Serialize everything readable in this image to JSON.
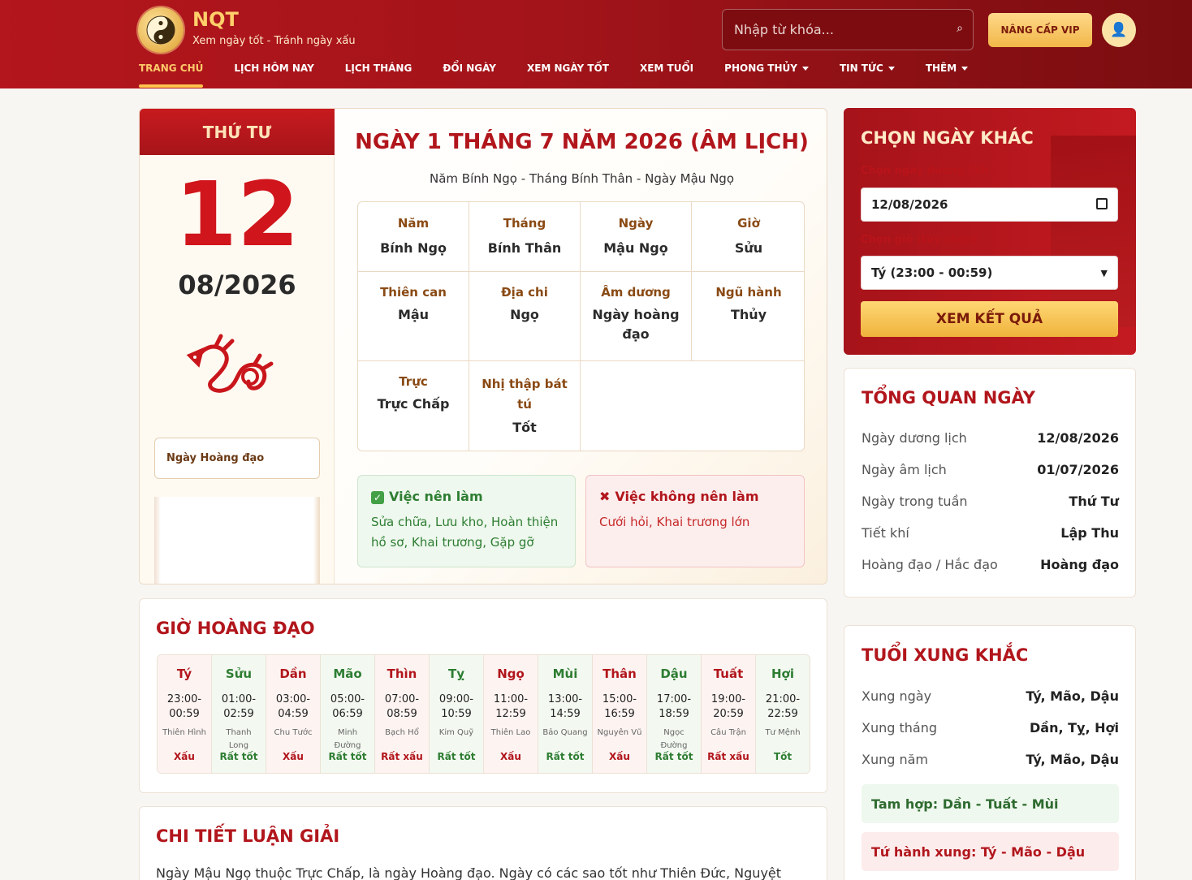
{
  "header": {
    "brand": "NQT",
    "tagline": "Xem ngày tốt - Tránh ngày xấu",
    "search_placeholder": "Nhập từ khóa...",
    "vip_label": "NÂNG CẤP VIP",
    "nav": [
      {
        "label": "TRANG CHỦ",
        "active": true
      },
      {
        "label": "LỊCH HÔM NAY"
      },
      {
        "label": "LỊCH THÁNG"
      },
      {
        "label": "ĐỔI NGÀY"
      },
      {
        "label": "XEM NGÀY TỐT"
      },
      {
        "label": "XEM TUỔI"
      },
      {
        "label": "PHONG THỦY",
        "dropdown": true
      },
      {
        "label": "TIN TỨC",
        "dropdown": true
      },
      {
        "label": "THÊM",
        "dropdown": true
      }
    ]
  },
  "date_card": {
    "weekday": "THỨ TƯ",
    "day": "12",
    "month_year": "08/2026",
    "hoangdao_label": "Ngày Hoàng đạo",
    "lunar_title": "NGÀY 1 THÁNG 7 NĂM 2026 (ÂM LỊCH)",
    "lunar_sub": "Năm Bính Ngọ - Tháng Bính Thân - Ngày Mậu Ngọ",
    "grid": {
      "nam": {
        "label": "Năm",
        "value": "Bính Ngọ"
      },
      "thang": {
        "label": "Tháng",
        "value": "Bính Thân"
      },
      "ngay": {
        "label": "Ngày",
        "value": "Mậu Ngọ"
      },
      "gio": {
        "label": "Giờ",
        "value": "Sửu"
      },
      "thien_can": {
        "label": "Thiên can",
        "value": "Mậu"
      },
      "dia_chi": {
        "label": "Địa chi",
        "value": "Ngọ"
      },
      "am_duong": {
        "label": "Âm dương",
        "value": "Ngày hoàng đạo"
      },
      "ngu_hanh": {
        "label": "Ngũ hành",
        "value": "Thủy"
      },
      "truc": {
        "label": "Trực",
        "value": "Trực Chấp"
      },
      "nhi_thap": {
        "label": "Nhị thập bát tú",
        "value": "Tốt"
      }
    },
    "do_title": "Việc nên làm",
    "do_text": "Sửa chữa, Lưu kho, Hoàn thiện hồ sơ, Khai trương, Gặp gỡ",
    "dont_title": "Việc không nên làm",
    "dont_text": "Cưới hỏi, Khai trương lớn"
  },
  "chon_ngay": {
    "title": "CHỌN NGÀY KHÁC",
    "date_label": "Chọn ngày dương lịch",
    "date_value": "12/08/2026",
    "hour_label": "Chọn giờ (tùy chọn)",
    "hour_value": "Tý (23:00 - 00:59)",
    "button": "XEM KẾT QUẢ"
  },
  "tong_quan": {
    "title": "TỔNG QUAN NGÀY",
    "rows": [
      {
        "k": "Ngày dương lịch",
        "v": "12/08/2026"
      },
      {
        "k": "Ngày âm lịch",
        "v": "01/07/2026"
      },
      {
        "k": "Ngày trong tuần",
        "v": "Thứ Tư"
      },
      {
        "k": "Tiết khí",
        "v": "Lập Thu"
      },
      {
        "k": "Hoàng đạo / Hắc đạo",
        "v": "Hoàng đạo"
      }
    ]
  },
  "xung_khac": {
    "title": "TUỔI XUNG KHẮC",
    "rows": [
      {
        "k": "Xung ngày",
        "v": "Tý, Mão, Dậu"
      },
      {
        "k": "Xung tháng",
        "v": "Dần, Tỵ, Hợi"
      },
      {
        "k": "Xung năm",
        "v": "Tý, Mão, Dậu"
      }
    ],
    "tam_hop": "Tam hợp: Dần - Tuất - Mùi",
    "tu_hanh_xung": "Tứ hành xung: Tý - Mão - Dậu"
  },
  "gio_hoang_dao": {
    "title": "GIỜ HOÀNG ĐẠO",
    "hours": [
      {
        "name": "Tý",
        "time": "23:00-00:59",
        "star": "Thiên Hình",
        "rating": "Xấu",
        "good": false
      },
      {
        "name": "Sửu",
        "time": "01:00-02:59",
        "star": "Thanh Long",
        "rating": "Rất tốt",
        "good": true
      },
      {
        "name": "Dần",
        "time": "03:00-04:59",
        "star": "Chu Tước",
        "rating": "Xấu",
        "good": false
      },
      {
        "name": "Mão",
        "time": "05:00-06:59",
        "star": "Minh Đường",
        "rating": "Rất tốt",
        "good": true
      },
      {
        "name": "Thìn",
        "time": "07:00-08:59",
        "star": "Bạch Hổ",
        "rating": "Rất xấu",
        "good": false
      },
      {
        "name": "Tỵ",
        "time": "09:00-10:59",
        "star": "Kim Quỹ",
        "rating": "Rất tốt",
        "good": true
      },
      {
        "name": "Ngọ",
        "time": "11:00-12:59",
        "star": "Thiên Lao",
        "rating": "Xấu",
        "good": false
      },
      {
        "name": "Mùi",
        "time": "13:00-14:59",
        "star": "Bảo Quang",
        "rating": "Rất tốt",
        "good": true
      },
      {
        "name": "Thân",
        "time": "15:00-16:59",
        "star": "Nguyên Vũ",
        "rating": "Xấu",
        "good": false
      },
      {
        "name": "Dậu",
        "time": "17:00-18:59",
        "star": "Ngọc Đường",
        "rating": "Rất tốt",
        "good": true
      },
      {
        "name": "Tuất",
        "time": "19:00-20:59",
        "star": "Câu Trận",
        "rating": "Rất xấu",
        "good": false
      },
      {
        "name": "Hợi",
        "time": "21:00-22:59",
        "star": "Tư Mệnh",
        "rating": "Tốt",
        "good": true
      }
    ]
  },
  "chi_tiet": {
    "title": "CHI TIẾT LUẬN GIẢI",
    "text": "Ngày Mậu Ngọ thuộc Trực Chấp, là ngày Hoàng đạo. Ngày có các sao tốt như Thiên Đức, Nguyệt Đức,"
  },
  "colors": {
    "brand_red": "#b1161c",
    "gold": "#f1b748",
    "good_green": "#2e7d32"
  }
}
